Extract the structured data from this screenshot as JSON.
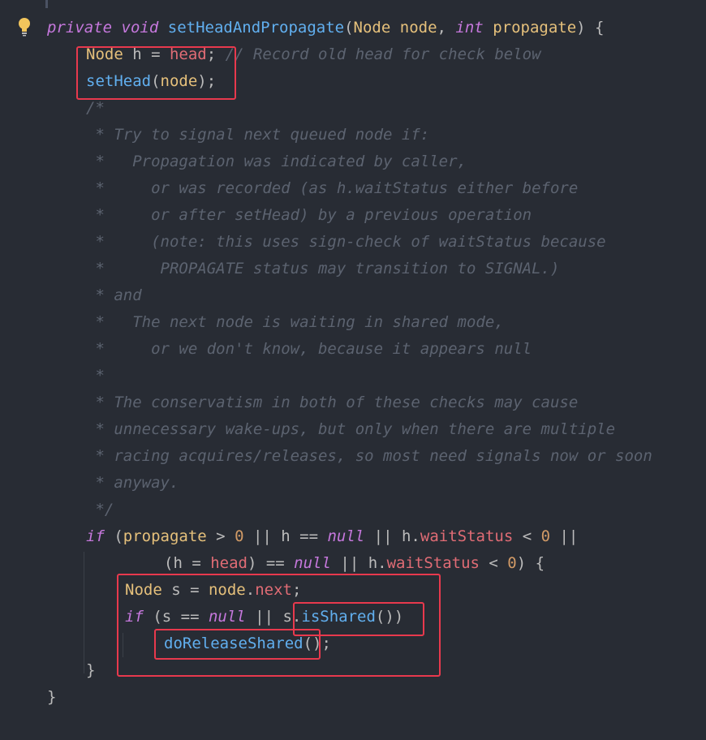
{
  "icons": {
    "gutter_hint": "lightbulb-icon"
  },
  "colors": {
    "background": "#282c34",
    "keyword": "#c678dd",
    "function": "#61afef",
    "type": "#e5c07b",
    "field": "#e06c75",
    "number": "#d19a66",
    "comment": "#5c6370",
    "highlight_box": "#e8394d"
  },
  "lines": [
    {
      "indent": 0,
      "tokens": [
        {
          "t": "kw",
          "v": "private"
        },
        {
          "t": "pl",
          "v": " "
        },
        {
          "t": "kw",
          "v": "void"
        },
        {
          "t": "pl",
          "v": " "
        },
        {
          "t": "fn",
          "v": "setHeadAndPropagate"
        },
        {
          "t": "pl",
          "v": "("
        },
        {
          "t": "type",
          "v": "Node"
        },
        {
          "t": "pl",
          "v": " "
        },
        {
          "t": "par",
          "v": "node"
        },
        {
          "t": "pl",
          "v": ", "
        },
        {
          "t": "kw",
          "v": "int"
        },
        {
          "t": "pl",
          "v": " "
        },
        {
          "t": "par",
          "v": "propagate"
        },
        {
          "t": "pl",
          "v": ") {"
        }
      ]
    },
    {
      "indent": 1,
      "tokens": [
        {
          "t": "type",
          "v": "Node"
        },
        {
          "t": "pl",
          "v": " h = "
        },
        {
          "t": "fld",
          "v": "head"
        },
        {
          "t": "pl",
          "v": "; "
        },
        {
          "t": "cm",
          "v": "// Record old head for check below"
        }
      ]
    },
    {
      "indent": 1,
      "tokens": [
        {
          "t": "fn",
          "v": "setHead"
        },
        {
          "t": "pl",
          "v": "("
        },
        {
          "t": "par",
          "v": "node"
        },
        {
          "t": "pl",
          "v": ");"
        }
      ]
    },
    {
      "indent": 1,
      "tokens": [
        {
          "t": "cm",
          "v": "/*"
        }
      ]
    },
    {
      "indent": 1,
      "tokens": [
        {
          "t": "cm",
          "v": " * Try to signal next queued node if:"
        }
      ]
    },
    {
      "indent": 1,
      "tokens": [
        {
          "t": "cm",
          "v": " *   Propagation was indicated by caller,"
        }
      ]
    },
    {
      "indent": 1,
      "tokens": [
        {
          "t": "cm",
          "v": " *     or was recorded (as h.waitStatus either before"
        }
      ]
    },
    {
      "indent": 1,
      "tokens": [
        {
          "t": "cm",
          "v": " *     or after setHead) by a previous operation"
        }
      ]
    },
    {
      "indent": 1,
      "tokens": [
        {
          "t": "cm",
          "v": " *     (note: this uses sign-check of waitStatus because"
        }
      ]
    },
    {
      "indent": 1,
      "tokens": [
        {
          "t": "cm",
          "v": " *      PROPAGATE status may transition to SIGNAL.)"
        }
      ]
    },
    {
      "indent": 1,
      "tokens": [
        {
          "t": "cm",
          "v": " * and"
        }
      ]
    },
    {
      "indent": 1,
      "tokens": [
        {
          "t": "cm",
          "v": " *   The next node is waiting in shared mode,"
        }
      ]
    },
    {
      "indent": 1,
      "tokens": [
        {
          "t": "cm",
          "v": " *     or we don't know, because it appears null"
        }
      ]
    },
    {
      "indent": 1,
      "tokens": [
        {
          "t": "cm",
          "v": " *"
        }
      ]
    },
    {
      "indent": 1,
      "tokens": [
        {
          "t": "cm",
          "v": " * The conservatism in both of these checks may cause"
        }
      ]
    },
    {
      "indent": 1,
      "tokens": [
        {
          "t": "cm",
          "v": " * unnecessary wake-ups, but only when there are multiple"
        }
      ]
    },
    {
      "indent": 1,
      "tokens": [
        {
          "t": "cm",
          "v": " * racing acquires/releases, so most need signals now or soon"
        }
      ]
    },
    {
      "indent": 1,
      "tokens": [
        {
          "t": "cm",
          "v": " * anyway."
        }
      ]
    },
    {
      "indent": 1,
      "tokens": [
        {
          "t": "cm",
          "v": " */"
        }
      ]
    },
    {
      "indent": 1,
      "tokens": [
        {
          "t": "kw",
          "v": "if"
        },
        {
          "t": "pl",
          "v": " ("
        },
        {
          "t": "par",
          "v": "propagate"
        },
        {
          "t": "pl",
          "v": " > "
        },
        {
          "t": "num",
          "v": "0"
        },
        {
          "t": "pl",
          "v": " || h == "
        },
        {
          "t": "kw",
          "v": "null"
        },
        {
          "t": "pl",
          "v": " || h."
        },
        {
          "t": "fld",
          "v": "waitStatus"
        },
        {
          "t": "pl",
          "v": " < "
        },
        {
          "t": "num",
          "v": "0"
        },
        {
          "t": "pl",
          "v": " ||"
        }
      ]
    },
    {
      "indent": 3,
      "tokens": [
        {
          "t": "pl",
          "v": "(h = "
        },
        {
          "t": "fld",
          "v": "head"
        },
        {
          "t": "pl",
          "v": ") == "
        },
        {
          "t": "kw",
          "v": "null"
        },
        {
          "t": "pl",
          "v": " || h."
        },
        {
          "t": "fld",
          "v": "waitStatus"
        },
        {
          "t": "pl",
          "v": " < "
        },
        {
          "t": "num",
          "v": "0"
        },
        {
          "t": "pl",
          "v": ") {"
        }
      ]
    },
    {
      "indent": 2,
      "tokens": [
        {
          "t": "type",
          "v": "Node"
        },
        {
          "t": "pl",
          "v": " s = "
        },
        {
          "t": "par",
          "v": "node"
        },
        {
          "t": "pl",
          "v": "."
        },
        {
          "t": "fld",
          "v": "next"
        },
        {
          "t": "pl",
          "v": ";"
        }
      ]
    },
    {
      "indent": 2,
      "tokens": [
        {
          "t": "kw",
          "v": "if"
        },
        {
          "t": "pl",
          "v": " (s == "
        },
        {
          "t": "kw",
          "v": "null"
        },
        {
          "t": "pl",
          "v": " || s."
        },
        {
          "t": "fn",
          "v": "isShared"
        },
        {
          "t": "pl",
          "v": "())"
        }
      ]
    },
    {
      "indent": 3,
      "tokens": [
        {
          "t": "fn",
          "v": "doReleaseShared"
        },
        {
          "t": "pl",
          "v": "();"
        }
      ]
    },
    {
      "indent": 1,
      "tokens": [
        {
          "t": "pl",
          "v": "}"
        }
      ]
    },
    {
      "indent": 0,
      "tokens": [
        {
          "t": "pl",
          "v": "}"
        }
      ]
    }
  ]
}
